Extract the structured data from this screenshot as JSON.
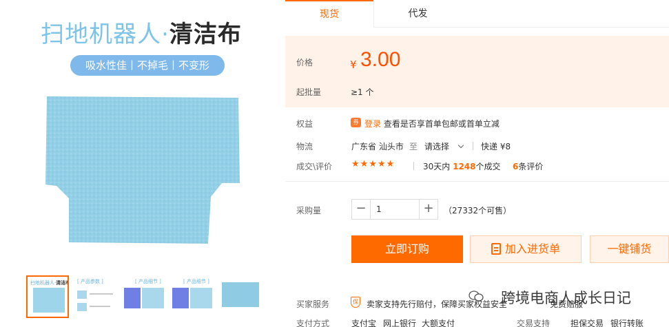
{
  "product_image": {
    "title_part1": "扫地机器人·",
    "title_part2": "清洁布",
    "features": "吸水性佳丨不掉毛丨不变形"
  },
  "thumbnails": [
    {
      "title_a": "扫地机器人·",
      "title_b": "清洁布"
    },
    {
      "title_a": "[ 产品参数 ]",
      "title_b": ""
    },
    {
      "title_a": "[ 产品细节 ]",
      "title_b": ""
    },
    {
      "title_a": "[ 产品细节 ]",
      "title_b": ""
    },
    {
      "title_a": "",
      "title_b": ""
    }
  ],
  "tabs": [
    "现货",
    "代发"
  ],
  "price": {
    "label": "价格",
    "currency": "¥",
    "value": "3.00",
    "moq_label": "起批量",
    "moq_value": "≥1 个"
  },
  "benefits": {
    "label": "权益",
    "login": "登录",
    "text": "查看是否享首单包邮或首单立减"
  },
  "logistics": {
    "label": "物流",
    "origin": "广东省 汕头市",
    "to": "至",
    "destination": "请选择",
    "express": "快递 ¥8"
  },
  "reviews": {
    "label": "成交\\评价",
    "stars": "★★★★★",
    "sales_prefix": "30天内",
    "sales_count": "1248",
    "sales_suffix": "个成交",
    "review_count": "6",
    "review_suffix": "条评价"
  },
  "purchase": {
    "label": "采购量",
    "quantity": "1",
    "stock": "（27332个可售）"
  },
  "buttons": {
    "buy": "立即订购",
    "cart": "加入进货单",
    "shop": "一键铺货"
  },
  "service": {
    "label": "买家服务",
    "text": "卖家支持先行赔付，保障买家权益安全",
    "extra": "免费赔服"
  },
  "payment": {
    "label": "支付方式",
    "methods": [
      "支付宝",
      "网上银行",
      "大额支付"
    ],
    "trade_label": "交易支持",
    "trade_items": [
      "担保交易",
      "银行转账"
    ]
  },
  "watermark": "跨境电商人成长日记",
  "colors": {
    "accent": "#ff6a00",
    "price": "#ff5000",
    "cloth": "#9fd5ea"
  }
}
